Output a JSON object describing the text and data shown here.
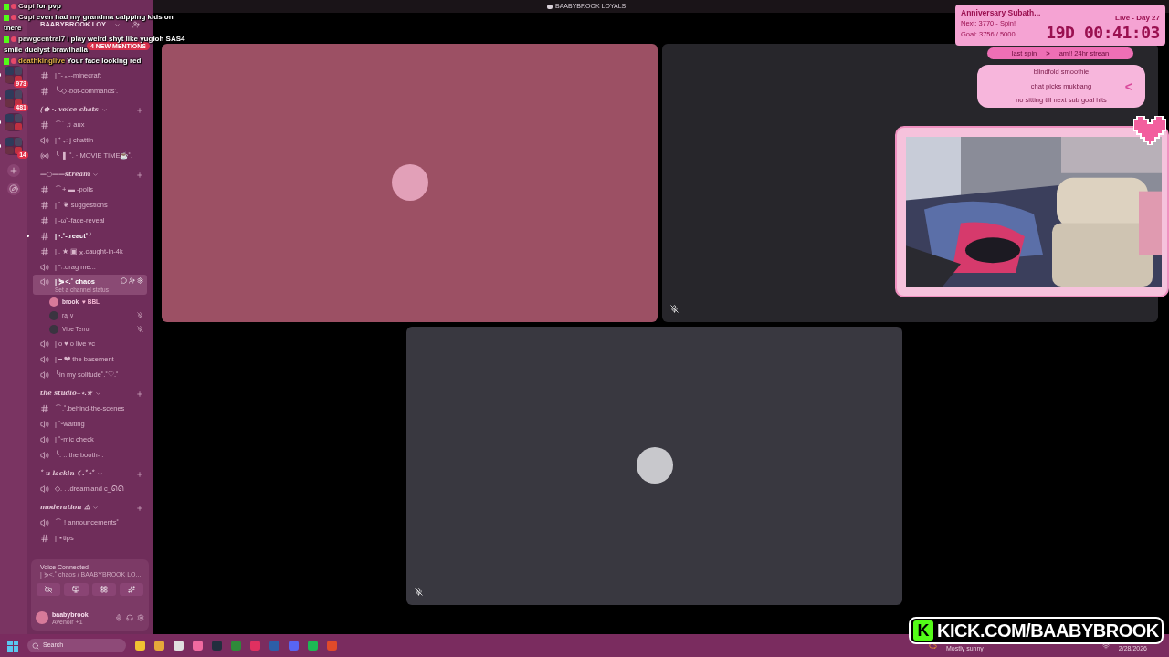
{
  "title_bar": {
    "title": "BAABYBROOK LOYALS"
  },
  "chat_overlay": [
    {
      "user": "Cupi",
      "color": "#f4dbe6",
      "lines": [
        "for pvp"
      ]
    },
    {
      "user": "Cupi",
      "color": "#f4dbe6",
      "lines": [
        "even had my grandma calpping kids on",
        "there"
      ]
    },
    {
      "user": "pawgcentral7",
      "color": "#f0e6ea",
      "lines": [
        "i play weird shyt like yugioh SAS4",
        "smile duelyst brawlhalla"
      ]
    },
    {
      "user": "deathkinglive",
      "color": "#e8b64a",
      "lines": [
        "Your face looking red"
      ]
    }
  ],
  "server_rail": {
    "servers": [
      {
        "unread": true,
        "badge": "973"
      },
      {
        "unread": true,
        "badge": "481"
      },
      {
        "unread": true
      },
      {
        "unread": true,
        "badge": "14"
      }
    ]
  },
  "server": {
    "name": "BAABYBROOK LOY...",
    "mentions": "4 NEW MENTIONS"
  },
  "channels": [
    {
      "kind": "text",
      "name": "| ˜-◞◟--minecraft",
      "unread": false,
      "selected": false
    },
    {
      "kind": "text",
      "name": "╰-◇-bot-commands'.",
      "unread": false,
      "selected": false
    },
    {
      "kind": "category",
      "name": "⟮ ✿ ·. voice chats"
    },
    {
      "kind": "text",
      "name": "⌒˙ ♫ aux",
      "unread": false,
      "selected": false
    },
    {
      "kind": "voice",
      "name": "| ⁺‧₊ː j chattin",
      "unread": false,
      "selected": false
    },
    {
      "kind": "stage",
      "name": "╰ ❚ ˚. · MOVIE TIME☕˚.",
      "unread": false,
      "selected": false
    },
    {
      "kind": "category",
      "name": "—○——stream"
    },
    {
      "kind": "text",
      "name": "⌒+ ▬ -polls",
      "unread": false,
      "selected": false
    },
    {
      "kind": "text",
      "name": "| ˚ ❦ suggestions",
      "unread": false,
      "selected": false
    },
    {
      "kind": "text",
      "name": "| -ω˘-face-reveal",
      "unread": false,
      "selected": false
    },
    {
      "kind": "text",
      "name": "| ·.˚-.react˚ ⁾",
      "unread": true,
      "selected": false
    },
    {
      "kind": "text",
      "name": "| . ★ ▣ ⁎.caught-in-4k",
      "unread": false,
      "selected": false
    },
    {
      "kind": "voice",
      "name": "| ˜˒.drag me...",
      "unread": false,
      "selected": false
    },
    {
      "kind": "voice",
      "name": "| ⋟<.˚ chaos",
      "unread": false,
      "selected": true,
      "status": "Set a channel status",
      "members": [
        {
          "name": "brook",
          "tag": "♥ BBL",
          "muted": false
        },
        {
          "name": "raj v",
          "muted": true
        },
        {
          "name": "Vibe Terror",
          "muted": true
        }
      ]
    },
    {
      "kind": "voice",
      "name": "| o ♥ o live vc",
      "unread": false,
      "selected": false
    },
    {
      "kind": "voice",
      "name": "| ⎯ ❤ the basement",
      "unread": false,
      "selected": false
    },
    {
      "kind": "voice",
      "name": "╰in my solitude˚.˚♡.˚",
      "unread": false,
      "selected": false
    },
    {
      "kind": "category",
      "name": "the studio⎯ ⋆.☆"
    },
    {
      "kind": "text",
      "name": "⌒.˚.behind-the-scenes",
      "unread": false,
      "selected": false
    },
    {
      "kind": "voice",
      "name": "| ˚ᵕwaiting",
      "unread": false,
      "selected": false
    },
    {
      "kind": "voice",
      "name": "| ˚ᵕmic check",
      "unread": false,
      "selected": false
    },
    {
      "kind": "voice",
      "name": "╰. .. the booth˖ .",
      "unread": false,
      "selected": false
    },
    {
      "kind": "category",
      "name": "˚ u lackin ☾.˚⋆˚"
    },
    {
      "kind": "voice",
      "name": "◇. . .dreamland c_ᘏᘏ",
      "unread": false,
      "selected": false
    },
    {
      "kind": "category",
      "name": "moderation ⚠"
    },
    {
      "kind": "voice",
      "name": "⌒ ! announcements˚",
      "unread": false,
      "selected": false
    },
    {
      "kind": "text",
      "name": "| ⋆tips",
      "unread": false,
      "selected": false
    }
  ],
  "voice_panel": {
    "status": "Voice Connected",
    "channel": "| ⋟<.˚ chaos / BAABYBROOK LO..."
  },
  "user_panel": {
    "name": "baabybrook",
    "activity": "Avenoir +1"
  },
  "tiles": [
    {
      "avatar": true,
      "muted": false
    },
    {
      "avatar": false,
      "muted": true
    },
    {
      "avatar": true,
      "muted": true
    }
  ],
  "subathon": {
    "title": "Anniversary Subath...",
    "next": "Next: 3770 - Spin!",
    "goal": "Goal: 3756 / 5000",
    "live": "Live - Day 27",
    "timer": "19D 00:41:03",
    "last_spin_label": "last spin",
    "arrow": ">",
    "last_spin": "am!! 24hr strean",
    "wheel_items": [
      "blindfold smoothie",
      "chat picks mukbang",
      "no sitting till next sub goal hits"
    ],
    "chevron": "<"
  },
  "kick": {
    "logo": "K",
    "url": "KICK.COM/BAABYBROOK"
  },
  "taskbar": {
    "search": "Search",
    "weather": "Mostly sunny",
    "date": "2/28/2026"
  }
}
